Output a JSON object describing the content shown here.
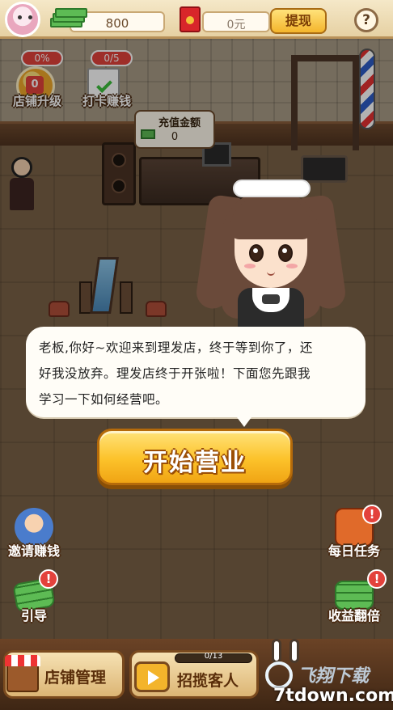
{
  "topbar": {
    "cash_value": "800",
    "cash_icon": "money-stack-icon",
    "red_packet_icon": "red-envelope-icon",
    "yuan_value": "0元",
    "withdraw_label": "提现",
    "help_label": "?"
  },
  "features_top": {
    "upgrade": {
      "badge": "0%",
      "count": "0",
      "label": "店铺升级"
    },
    "checkin": {
      "badge": "0/5",
      "label": "打卡赚钱"
    }
  },
  "recharge": {
    "title": "充值金额",
    "value": "0"
  },
  "dialog": {
    "line1": "老板,你好~欢迎来到理发店，终于等到你了，还",
    "line2": "好我没放弃。理发店终于开张啦！下面您先跟我",
    "line3": "学习一下如何经营吧。"
  },
  "start_button": {
    "label": "开始营业"
  },
  "side_left": [
    {
      "label": "邀请赚钱",
      "icon": "invite-person-icon"
    },
    {
      "label": "引导",
      "icon": "cash-pile-icon",
      "alert": "!"
    }
  ],
  "side_right": [
    {
      "label": "每日任务",
      "icon": "scissors-icon",
      "alert": "!"
    },
    {
      "label": "收益翻倍",
      "icon": "double-income-icon",
      "alert": "!"
    }
  ],
  "bottom": {
    "shop_manage_label": "店铺管理",
    "recruit_label": "招揽客人",
    "recruit_progress": "0/13",
    "recruit_progress_fraction": 0
  },
  "watermark": {
    "top": "飞翔下载",
    "bottom": "7tdown.com"
  }
}
